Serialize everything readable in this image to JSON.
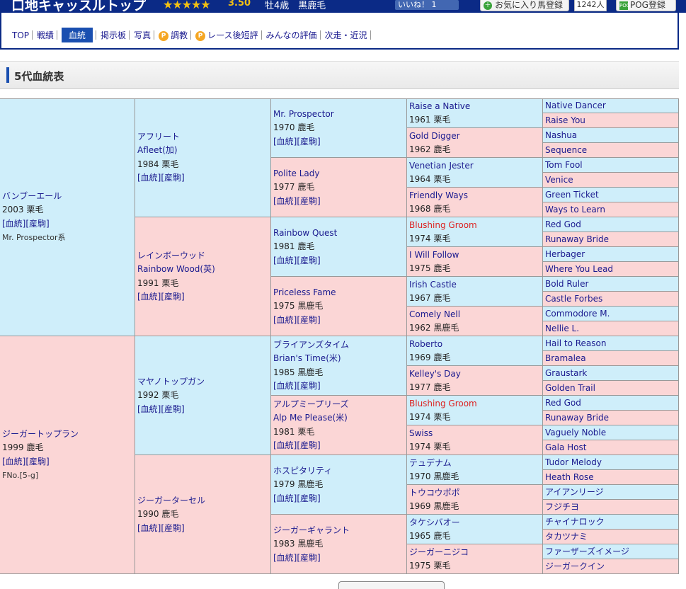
{
  "header": {
    "title": "口地キャッスルトップ",
    "stars": "★★★★★",
    "rating": "3.50",
    "info": "牡4歳　黒鹿毛",
    "like_label": "いいね！ 1",
    "fav_icon": "＋",
    "fav_label": "お気に入り馬登録",
    "fav_count": "1242人",
    "pog_icon": "POG",
    "pog_label": "POG登録"
  },
  "tabs": [
    {
      "label": "TOP"
    },
    {
      "label": "戦績"
    },
    {
      "label": "血統",
      "active": true
    },
    {
      "label": "掲示板"
    },
    {
      "label": "写真"
    },
    {
      "label": "調教",
      "p_icon": "P"
    },
    {
      "label": "レース後短評",
      "p_icon": "P"
    },
    {
      "label": "みんなの評価"
    },
    {
      "label": "次走・近況"
    }
  ],
  "section": {
    "title": "5代血統表"
  },
  "link_pedigree": "[血統]",
  "link_sales": "[産駒]",
  "gen1": [
    {
      "name": "バンブーエール",
      "year": "2003 栗毛",
      "line": "Mr. Prospector系"
    },
    {
      "name": "ジーガートップラン",
      "year": "1999 鹿毛",
      "line": "FNo.[5-g]"
    }
  ],
  "gen2": [
    {
      "name": "アフリート",
      "name2": "Afleet(加)",
      "year": "1984 栗毛"
    },
    {
      "name": "レインボーウッド",
      "name2": "Rainbow Wood(英)",
      "year": "1991 栗毛"
    },
    {
      "name": "マヤノトップガン",
      "year": "1992 栗毛"
    },
    {
      "name": "ジーガーターセル",
      "year": "1990 鹿毛"
    }
  ],
  "gen3": [
    {
      "name": "Mr. Prospector",
      "year": "1970 鹿毛"
    },
    {
      "name": "Polite Lady",
      "year": "1977 鹿毛"
    },
    {
      "name": "Rainbow Quest",
      "year": "1981 鹿毛"
    },
    {
      "name": "Priceless Fame",
      "year": "1975 黒鹿毛"
    },
    {
      "name": "ブライアンズタイム",
      "name2": "Brian's Time(米)",
      "year": "1985 黒鹿毛"
    },
    {
      "name": "アルプミープリーズ",
      "name2": "Alp Me Please(米)",
      "year": "1981 栗毛"
    },
    {
      "name": "ホスピタリティ",
      "year": "1979 黒鹿毛"
    },
    {
      "name": "ジーガーギャラント",
      "year": "1983 黒鹿毛"
    }
  ],
  "gen4": [
    {
      "name": "Raise a Native",
      "year": "1961 栗毛"
    },
    {
      "name": "Gold Digger",
      "year": "1962 鹿毛"
    },
    {
      "name": "Venetian Jester",
      "year": "1964 栗毛"
    },
    {
      "name": "Friendly Ways",
      "year": "1968 鹿毛"
    },
    {
      "name": "Blushing Groom",
      "year": "1974 栗毛",
      "red": true
    },
    {
      "name": "I Will Follow",
      "year": "1975 鹿毛"
    },
    {
      "name": "Irish Castle",
      "year": "1967 鹿毛"
    },
    {
      "name": "Comely Nell",
      "year": "1962 黒鹿毛"
    },
    {
      "name": "Roberto",
      "year": "1969 鹿毛"
    },
    {
      "name": "Kelley's Day",
      "year": "1977 鹿毛"
    },
    {
      "name": "Blushing Groom",
      "year": "1974 栗毛",
      "red": true
    },
    {
      "name": "Swiss",
      "year": "1974 栗毛"
    },
    {
      "name": "テュデナム",
      "year": "1970 黒鹿毛"
    },
    {
      "name": "トウコウポポ",
      "year": "1969 黒鹿毛"
    },
    {
      "name": "タケシバオー",
      "year": "1965 鹿毛"
    },
    {
      "name": "ジーガーニジコ",
      "year": "1975 栗毛"
    }
  ],
  "gen5": [
    "Native Dancer",
    "Raise You",
    "Nashua",
    "Sequence",
    "Tom Fool",
    "Venice",
    "Green Ticket",
    "Ways to Learn",
    "Red God",
    "Runaway Bride",
    "Herbager",
    "Where You Lead",
    "Bold Ruler",
    "Castle Forbes",
    "Commodore M.",
    "Nellie L.",
    "Hail to Reason",
    "Bramalea",
    "Graustark",
    "Golden Trail",
    "Red God",
    "Runaway Bride",
    "Vaguely Noble",
    "Gala Host",
    "Tudor Melody",
    "Heath Rose",
    "アイアンリージ",
    "フジチヨ",
    "チャイナロック",
    "タカツナミ",
    "ファーザーズイメージ",
    "ジーガークイン"
  ]
}
